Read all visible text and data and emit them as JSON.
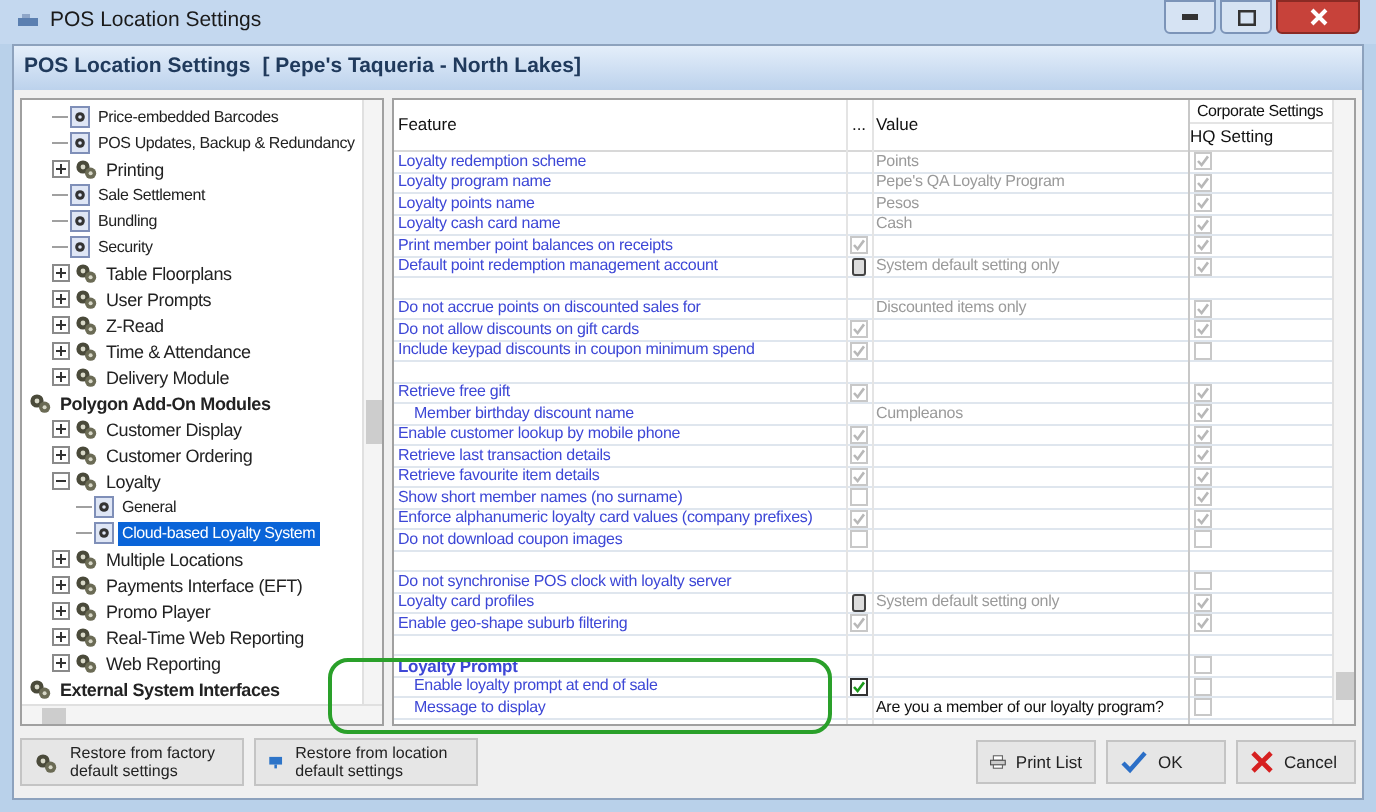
{
  "window": {
    "title": "POS Location Settings"
  },
  "header": {
    "title": "POS Location Settings",
    "location": "[ Pepe's Taqueria - North Lakes]"
  },
  "tree": {
    "items": [
      {
        "children": [
          {
            "label": "Price-embedded Barcodes",
            "kind": "leaf",
            "selected": false
          },
          {
            "label": "POS Updates, Backup & Redundancy",
            "kind": "leaf",
            "selected": false
          },
          {
            "label": "Printing",
            "kind": "group",
            "expanded": false,
            "selected": false
          },
          {
            "label": "Sale Settlement",
            "kind": "leaf",
            "selected": false
          },
          {
            "label": "Bundling",
            "kind": "leaf",
            "selected": false
          },
          {
            "label": "Security",
            "kind": "leaf",
            "selected": false
          },
          {
            "label": "Table Floorplans",
            "kind": "group",
            "expanded": false,
            "selected": false
          },
          {
            "label": "User Prompts",
            "kind": "group",
            "expanded": false,
            "selected": false
          },
          {
            "label": "Z-Read",
            "kind": "group",
            "expanded": false,
            "selected": false
          },
          {
            "label": "Time & Attendance",
            "kind": "group",
            "expanded": false,
            "selected": false
          },
          {
            "label": "Delivery Module",
            "kind": "group",
            "expanded": false,
            "selected": false
          }
        ]
      },
      {
        "label": "Polygon Add-On Modules",
        "kind": "category",
        "selected": false,
        "children": [
          {
            "label": "Customer Display",
            "kind": "group",
            "expanded": false,
            "selected": false
          },
          {
            "label": "Customer Ordering",
            "kind": "group",
            "expanded": false,
            "selected": false
          },
          {
            "label": "Loyalty",
            "kind": "group",
            "expanded": true,
            "selected": false,
            "children": [
              {
                "label": "General",
                "kind": "leaf",
                "selected": false
              },
              {
                "label": "Cloud-based Loyalty System",
                "kind": "leaf",
                "selected": true
              }
            ]
          },
          {
            "label": "Multiple Locations",
            "kind": "group",
            "expanded": false,
            "selected": false
          },
          {
            "label": "Payments Interface (EFT)",
            "kind": "group",
            "expanded": false,
            "selected": false
          },
          {
            "label": "Promo Player",
            "kind": "group",
            "expanded": false,
            "selected": false
          },
          {
            "label": "Real-Time Web Reporting",
            "kind": "group",
            "expanded": false,
            "selected": false
          },
          {
            "label": "Web Reporting",
            "kind": "group",
            "expanded": false,
            "selected": false
          }
        ]
      },
      {
        "label": "External System Interfaces",
        "kind": "category",
        "selected": false
      }
    ]
  },
  "table": {
    "columns": [
      "Feature",
      "...",
      "Value"
    ],
    "column_group": {
      "label": "Corporate Settings",
      "columns": [
        "HQ Setting"
      ]
    },
    "rows": [
      {
        "kind": "setting",
        "feature": "Loyalty redemption scheme",
        "indented": false,
        "value": "Points",
        "disabled": true,
        "hq_checked": true
      },
      {
        "kind": "setting",
        "feature": "Loyalty program name",
        "indented": false,
        "value": "Pepe's QA Loyalty Program",
        "disabled": true,
        "hq_checked": true
      },
      {
        "kind": "setting",
        "feature": "Loyalty points name",
        "indented": false,
        "value": "Pesos",
        "disabled": true,
        "hq_checked": true
      },
      {
        "kind": "setting",
        "feature": "Loyalty cash card name",
        "indented": false,
        "value": "Cash",
        "disabled": true,
        "hq_checked": true
      },
      {
        "kind": "setting",
        "feature": "Print member point balances on receipts",
        "indented": false,
        "control": {
          "kind": "check",
          "checked": true
        },
        "disabled": true,
        "hq_checked": true
      },
      {
        "kind": "setting",
        "feature": "Default point redemption management account",
        "indented": false,
        "control": {
          "kind": "ellipsis"
        },
        "value": "System default setting only",
        "disabled": true,
        "hq_checked": true
      },
      {
        "kind": "blank"
      },
      {
        "kind": "setting",
        "feature": "Do not accrue points on discounted sales for",
        "indented": false,
        "value": "Discounted items only",
        "disabled": true,
        "hq_checked": true
      },
      {
        "kind": "setting",
        "feature": "Do not allow discounts on gift cards",
        "indented": false,
        "control": {
          "kind": "check",
          "checked": true
        },
        "disabled": true,
        "hq_checked": true
      },
      {
        "kind": "setting",
        "feature": "Include keypad discounts in coupon minimum spend",
        "indented": false,
        "control": {
          "kind": "check",
          "checked": true
        },
        "disabled": true,
        "hq_checked": false
      },
      {
        "kind": "blank"
      },
      {
        "kind": "setting",
        "feature": "Retrieve free gift",
        "indented": false,
        "control": {
          "kind": "check",
          "checked": true
        },
        "disabled": true,
        "hq_checked": true
      },
      {
        "kind": "setting",
        "feature": "Member birthday discount name",
        "indented": true,
        "value": "Cumpleanos",
        "disabled": true,
        "hq_checked": true
      },
      {
        "kind": "setting",
        "feature": "Enable customer lookup by mobile phone",
        "indented": false,
        "control": {
          "kind": "check",
          "checked": true
        },
        "disabled": true,
        "hq_checked": true
      },
      {
        "kind": "setting",
        "feature": "Retrieve last transaction details",
        "indented": false,
        "control": {
          "kind": "check",
          "checked": true
        },
        "disabled": true,
        "hq_checked": true
      },
      {
        "kind": "setting",
        "feature": "Retrieve favourite item details",
        "indented": false,
        "control": {
          "kind": "check",
          "checked": true
        },
        "disabled": true,
        "hq_checked": true
      },
      {
        "kind": "setting",
        "feature": "Show short member names (no surname)",
        "indented": false,
        "control": {
          "kind": "check",
          "checked": false
        },
        "disabled": true,
        "hq_checked": true
      },
      {
        "kind": "setting",
        "feature": "Enforce alphanumeric loyalty card values (company prefixes)",
        "indented": false,
        "control": {
          "kind": "check",
          "checked": true
        },
        "disabled": true,
        "hq_checked": true
      },
      {
        "kind": "setting",
        "feature": "Do not download coupon images",
        "indented": false,
        "control": {
          "kind": "check",
          "checked": false
        },
        "disabled": true,
        "hq_checked": false
      },
      {
        "kind": "blank"
      },
      {
        "kind": "setting",
        "feature": "Do not synchronise POS clock with loyalty server",
        "indented": false,
        "hq_checked": false
      },
      {
        "kind": "setting",
        "feature": "Loyalty card profiles",
        "indented": false,
        "control": {
          "kind": "ellipsis"
        },
        "value": "System default setting only",
        "disabled": true,
        "hq_checked": true
      },
      {
        "kind": "setting",
        "feature": "Enable geo-shape suburb filtering",
        "indented": false,
        "control": {
          "kind": "check",
          "checked": true
        },
        "disabled": true,
        "hq_checked": true
      },
      {
        "kind": "blank"
      },
      {
        "kind": "heading",
        "feature": "Loyalty Prompt",
        "hq_checked": false
      },
      {
        "kind": "setting",
        "feature": "Enable loyalty prompt at end of sale",
        "indented": true,
        "control": {
          "kind": "check",
          "checked": true
        },
        "disabled": false,
        "hq_checked": false
      },
      {
        "kind": "setting",
        "feature": "Message to display",
        "indented": true,
        "value": "Are you a member of our loyalty program?",
        "disabled": false,
        "hq_checked": false
      }
    ]
  },
  "actions_left": [
    {
      "label": "Restore from factory default settings",
      "kind": "gears"
    },
    {
      "label": "Restore from location default settings",
      "kind": "monitor"
    }
  ],
  "actions_right": [
    {
      "label": "Print List",
      "kind": "printer"
    },
    {
      "label": "OK",
      "kind": "check"
    },
    {
      "label": "Cancel",
      "kind": "cross"
    }
  ]
}
